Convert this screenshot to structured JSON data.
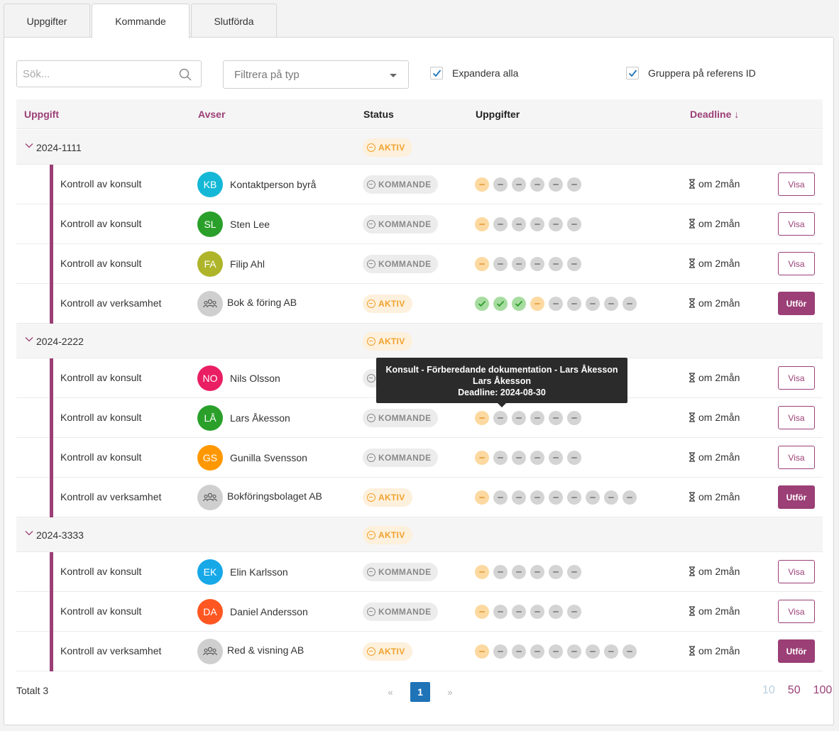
{
  "tabs": [
    "Uppgifter",
    "Kommande",
    "Slutförda"
  ],
  "active_tab": "Kommande",
  "search": {
    "placeholder": "Sök..."
  },
  "filter": {
    "placeholder": "Filtrera på typ"
  },
  "checkboxes": {
    "expand_all": "Expandera alla",
    "group_by_ref": "Gruppera på referens ID"
  },
  "columns": {
    "task": "Uppgift",
    "concerns": "Avser",
    "status": "Status",
    "tasks": "Uppgifter",
    "deadline": "Deadline ↓"
  },
  "colors": {
    "brand": "#9b3f76",
    "active_status": "#f0a22e",
    "page_active": "#1f73b7"
  },
  "groups": [
    {
      "id": "2024-1111",
      "status": "AKTIV",
      "rows": [
        {
          "task": "Kontroll av konsult",
          "initials": "KB",
          "avatar_color": "#14b8d6",
          "who": "Kontaktperson byrå",
          "status": "KOMMANDE",
          "dots": [
            "pending",
            "none",
            "none",
            "none",
            "none",
            "none"
          ],
          "deadline": "om 2mån",
          "action": "Visa"
        },
        {
          "task": "Kontroll av konsult",
          "initials": "SL",
          "avatar_color": "#2aa02a",
          "who": "Sten Lee",
          "status": "KOMMANDE",
          "dots": [
            "pending",
            "none",
            "none",
            "none",
            "none",
            "none"
          ],
          "deadline": "om 2mån",
          "action": "Visa"
        },
        {
          "task": "Kontroll av konsult",
          "initials": "FA",
          "avatar_color": "#afb52a",
          "who": "Filip Ahl",
          "status": "KOMMANDE",
          "dots": [
            "pending",
            "none",
            "none",
            "none",
            "none",
            "none"
          ],
          "deadline": "om 2mån",
          "action": "Visa"
        },
        {
          "task": "Kontroll av verksamhet",
          "initials": "",
          "avatar_color": "group",
          "who": "Bok & föring AB",
          "status": "AKTIV",
          "dots": [
            "done",
            "done",
            "done",
            "pending",
            "none",
            "none",
            "none",
            "none",
            "none"
          ],
          "deadline": "om 2mån",
          "action": "Utför"
        }
      ]
    },
    {
      "id": "2024-2222",
      "status": "AKTIV",
      "rows": [
        {
          "task": "Kontroll av konsult",
          "initials": "NO",
          "avatar_color": "#e91e63",
          "who": "Nils Olsson",
          "status": "KOMMANDE",
          "dots": [
            "pending",
            "none",
            "none",
            "none",
            "none",
            "none"
          ],
          "deadline": "om 2mån",
          "action": "Visa"
        },
        {
          "task": "Kontroll av konsult",
          "initials": "LÅ",
          "avatar_color": "#2aa02a",
          "who": "Lars Åkesson",
          "status": "KOMMANDE",
          "dots": [
            "pending",
            "none",
            "none",
            "none",
            "none",
            "none"
          ],
          "deadline": "om 2mån",
          "action": "Visa"
        },
        {
          "task": "Kontroll av konsult",
          "initials": "GS",
          "avatar_color": "#ff9800",
          "who": "Gunilla Svensson",
          "status": "KOMMANDE",
          "dots": [
            "pending",
            "none",
            "none",
            "none",
            "none",
            "none"
          ],
          "deadline": "om 2mån",
          "action": "Visa"
        },
        {
          "task": "Kontroll av verksamhet",
          "initials": "",
          "avatar_color": "group",
          "who": "Bokföringsbolaget AB",
          "status": "AKTIV",
          "dots": [
            "pending",
            "none",
            "none",
            "none",
            "none",
            "none",
            "none",
            "none",
            "none"
          ],
          "deadline": "om 2mån",
          "action": "Utför"
        }
      ]
    },
    {
      "id": "2024-3333",
      "status": "AKTIV",
      "rows": [
        {
          "task": "Kontroll av konsult",
          "initials": "EK",
          "avatar_color": "#17a8e8",
          "who": "Elin Karlsson",
          "status": "KOMMANDE",
          "dots": [
            "pending",
            "none",
            "none",
            "none",
            "none",
            "none"
          ],
          "deadline": "om 2mån",
          "action": "Visa"
        },
        {
          "task": "Kontroll av konsult",
          "initials": "DA",
          "avatar_color": "#ff5722",
          "who": "Daniel Andersson",
          "status": "KOMMANDE",
          "dots": [
            "pending",
            "none",
            "none",
            "none",
            "none",
            "none"
          ],
          "deadline": "om 2mån",
          "action": "Visa"
        },
        {
          "task": "Kontroll av verksamhet",
          "initials": "",
          "avatar_color": "group",
          "who": "Red & visning AB",
          "status": "AKTIV",
          "dots": [
            "pending",
            "none",
            "none",
            "none",
            "none",
            "none",
            "none",
            "none",
            "none"
          ],
          "deadline": "om 2mån",
          "action": "Utför"
        }
      ]
    }
  ],
  "tooltip": {
    "line1": "Konsult - Förberedande dokumentation - Lars Åkesson",
    "line2": "Lars Åkesson",
    "line3": "Deadline: 2024-08-30"
  },
  "footer": {
    "total": "Totalt 3",
    "prev": "«",
    "page": "1",
    "next": "»",
    "sizes": [
      "10",
      "50",
      "100"
    ]
  }
}
